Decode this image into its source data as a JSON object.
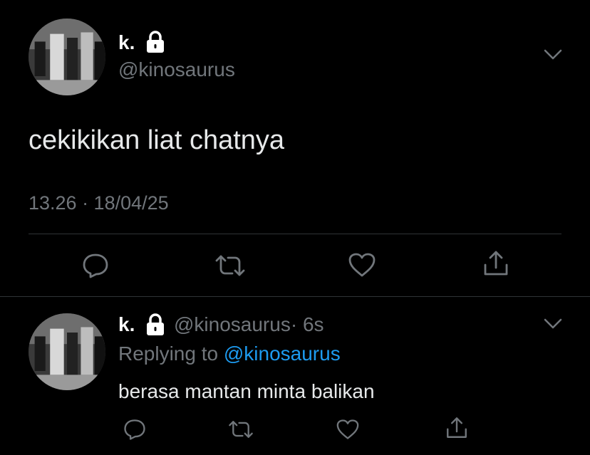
{
  "main_tweet": {
    "display_name": "k.",
    "handle": "@kinosaurus",
    "text": "cekikikan liat chatnya",
    "timestamp": "13.26 · 18/04/25",
    "icons": [
      "lock-icon",
      "chevron-down-icon",
      "reply-icon",
      "retweet-icon",
      "like-icon",
      "share-icon"
    ]
  },
  "reply_tweet": {
    "display_name": "k.",
    "handle": "@kinosaurus",
    "time": "· 6s",
    "replying_prefix": "Replying to",
    "replying_handle": "@kinosaurus",
    "text": "berasa mantan minta balikan",
    "icons": [
      "lock-icon",
      "chevron-down-icon",
      "reply-icon",
      "retweet-icon",
      "like-icon",
      "share-icon"
    ]
  },
  "colors": {
    "background": "#000000",
    "primary_text": "#e7e9ea",
    "secondary_text": "#71767b",
    "link": "#1d9bf0",
    "divider": "#2f3336"
  }
}
